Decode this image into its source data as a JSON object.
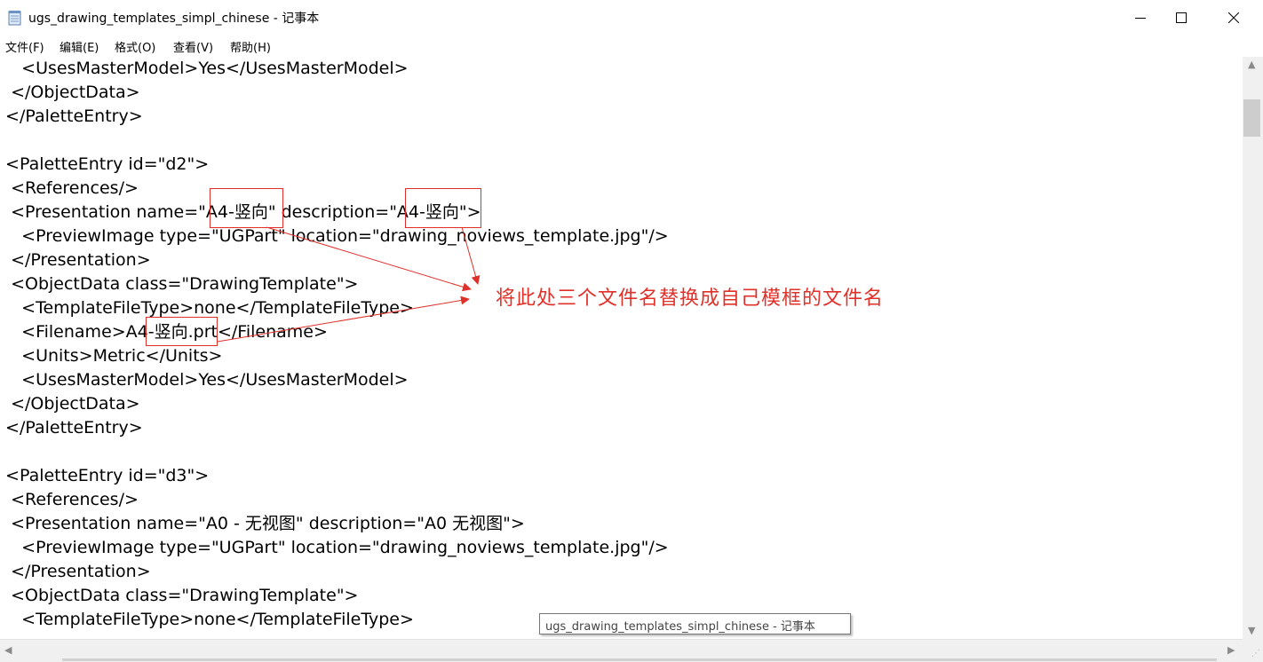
{
  "window": {
    "title": "ugs_drawing_templates_simpl_chinese - 记事本",
    "buttons": [
      "minimize",
      "maximize",
      "close"
    ]
  },
  "menu": [
    {
      "label": "文件(F)"
    },
    {
      "label": "编辑(E)"
    },
    {
      "label": "格式(O)"
    },
    {
      "label": "查看(V)"
    },
    {
      "label": "帮助(H)"
    }
  ],
  "editor": {
    "lines": [
      "    <UsesMasterModel>Yes</UsesMasterModel>",
      "  </ObjectData>",
      " </PaletteEntry>",
      "",
      " <PaletteEntry id=\"d2\">",
      "  <References/>",
      "  <Presentation name=\"A4-竖向\" description=\"A4-竖向\">",
      "    <PreviewImage type=\"UGPart\" location=\"drawing_noviews_template.jpg\"/>",
      "  </Presentation>",
      "  <ObjectData class=\"DrawingTemplate\">",
      "    <TemplateFileType>none</TemplateFileType>",
      "    <Filename>A4-竖向.prt</Filename>",
      "    <Units>Metric</Units>",
      "    <UsesMasterModel>Yes</UsesMasterModel>",
      "  </ObjectData>",
      " </PaletteEntry>",
      "",
      " <PaletteEntry id=\"d3\">",
      "  <References/>",
      "  <Presentation name=\"A0 - 无视图\" description=\"A0 无视图\">",
      "    <PreviewImage type=\"UGPart\" location=\"drawing_noviews_template.jpg\"/>",
      "  </Presentation>",
      "  <ObjectData class=\"DrawingTemplate\">",
      "    <TemplateFileType>none</TemplateFileType>"
    ]
  },
  "annotation": {
    "note": "将此处三个文件名替换成自己模框的文件名",
    "color": "#e0302a"
  },
  "tooltip": {
    "text": "ugs_drawing_templates_simpl_chinese - 记事本"
  }
}
